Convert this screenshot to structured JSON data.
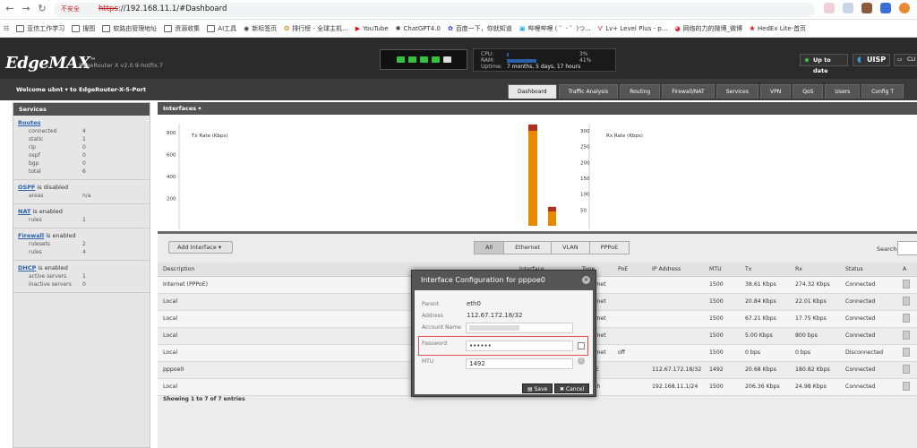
{
  "browser": {
    "warning": "不安全",
    "url_proto": "https",
    "url_rest": "://192.168.11.1/#Dashboard",
    "bookmarks": [
      "亚信工作学习",
      "搜图",
      "软路由管理地址",
      "资源收集",
      "AI工具",
      "新标签页",
      "排行榜 - 全球主机...",
      "YouTube",
      "ChatGPT4.0",
      "百度一下，你就知道",
      "哔哩哔哩 ( ゜- ゜)つ...",
      "Lv+ Level Plus - p...",
      "网络的力的微博_微博",
      "HedEx Lite-首页"
    ]
  },
  "header": {
    "logo": "EdgeMAX",
    "version": "EdgeRouter X v2.0.9-hotfix.7",
    "cpu_label": "CPU:",
    "ram_label": "RAM:",
    "uptime_label": "Uptime:",
    "cpu_value": "3%",
    "ram_value": "41%",
    "cpu_fraction": 0.03,
    "ram_fraction": 0.41,
    "uptime_value": "7 months, 5 days, 17 hours",
    "up_to_date": "Up to date",
    "uisp": "UISP",
    "cli": "CLI"
  },
  "nav": {
    "welcome": "Welcome ubnt  ▾   to EdgeRouter-X-5-Port",
    "tabs": [
      "Dashboard",
      "Traffic Analysis",
      "Routing",
      "Firewall/NAT",
      "Services",
      "VPN",
      "QoS",
      "Users",
      "Config T"
    ]
  },
  "services": {
    "title": "Services",
    "routes": {
      "link": "Routes",
      "rows": [
        [
          "connected",
          "4"
        ],
        [
          "static",
          "1"
        ],
        [
          "rip",
          "0"
        ],
        [
          "ospf",
          "0"
        ],
        [
          "bgp",
          "0"
        ],
        [
          "total",
          "6"
        ]
      ]
    },
    "ospf": {
      "link": "OSPF",
      "status": " is disabled",
      "rows": [
        [
          "areas",
          "n/a"
        ]
      ]
    },
    "nat": {
      "link": "NAT",
      "status": " is enabled",
      "rows": [
        [
          "rules",
          "1"
        ]
      ]
    },
    "firewall": {
      "link": "Firewall",
      "status": " is enabled",
      "rows": [
        [
          "rulesets",
          "2"
        ],
        [
          "rules",
          "4"
        ]
      ]
    },
    "dhcp": {
      "link": "DHCP",
      "status": " is enabled",
      "rows": [
        [
          "active servers",
          "1"
        ],
        [
          "inactive servers",
          "0"
        ]
      ]
    }
  },
  "interfaces_header": "Interfaces  ▾",
  "chart_data": [
    {
      "type": "bar",
      "title": "Tx Rate (Kbps)",
      "ylim": [
        0,
        800
      ],
      "yticks": [
        "800",
        "600",
        "400",
        "200"
      ]
    },
    {
      "type": "bar",
      "title": "Rx Rate (Kbps)",
      "ylim": [
        0,
        300
      ],
      "yticks": [
        "300",
        "250",
        "200",
        "150",
        "100",
        "50"
      ],
      "series": [
        {
          "color": "#e68a00",
          "values": [
            300,
            45
          ]
        },
        {
          "color": "#b03020",
          "values": [
            20,
            15
          ]
        }
      ]
    }
  ],
  "toolbar": {
    "add_interface": "Add Interface  ▾",
    "filters": [
      "All",
      "Ethernet",
      "VLAN",
      "PPPoE"
    ],
    "search": "Search"
  },
  "table": {
    "headers": [
      "Description",
      "Interface",
      "Type",
      "PoE",
      "IP Address",
      "MTU",
      "Tx",
      "Rx",
      "Status",
      "A"
    ],
    "rows": [
      [
        "Internet (PPPoE)",
        "",
        "Ethernet",
        "",
        "",
        "1500",
        "38.61 Kbps",
        "274.32 Kbps",
        "Connected"
      ],
      [
        "Local",
        "",
        "Ethernet",
        "",
        "",
        "1500",
        "20.84 Kbps",
        "22.01 Kbps",
        "Connected"
      ],
      [
        "Local",
        "",
        "Ethernet",
        "",
        "",
        "1500",
        "67.21 Kbps",
        "17.75 Kbps",
        "Connected"
      ],
      [
        "Local",
        "",
        "Ethernet",
        "",
        "",
        "1500",
        "5.00 Kbps",
        "800 bps",
        "Connected"
      ],
      [
        "Local",
        "",
        "Ethernet",
        "off",
        "",
        "1500",
        "0 bps",
        "0 bps",
        "Disconnected"
      ],
      [
        "pppoe0",
        "",
        "PPPoE",
        "",
        "112.67.172.18/32",
        "1492",
        "20.68 Kbps",
        "180.82 Kbps",
        "Connected"
      ],
      [
        "Local",
        "",
        "Switch",
        "",
        "192.168.11.1/24",
        "1500",
        "206.36 Kbps",
        "24.98 Kbps",
        "Connected"
      ]
    ],
    "footer": "Showing 1 to 7 of 7 entries"
  },
  "modal": {
    "title": "Interface Configuration for pppoe0",
    "parent_label": "Parent",
    "parent_value": "eth0",
    "address_label": "Address",
    "address_value": "112.67.172.18/32",
    "account_label": "Account Name",
    "password_label": "Password",
    "password_value": "••••••",
    "mtu_label": "MTU",
    "mtu_value": "1492",
    "save": "Save",
    "cancel": "Cancel"
  }
}
